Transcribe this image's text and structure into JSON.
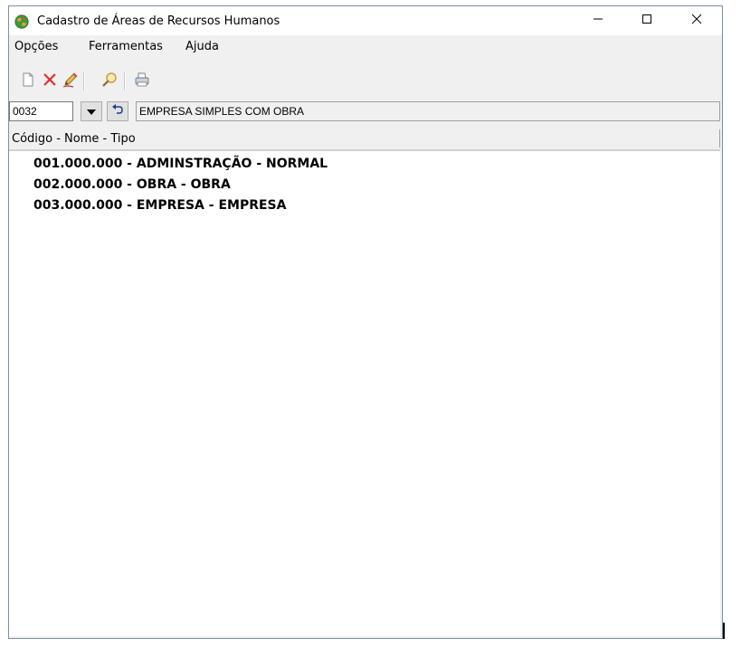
{
  "window": {
    "title": "Cadastro de Áreas de Recursos Humanos",
    "app_icon": "globe-icon",
    "controls": {
      "minimize": "minimize-icon",
      "maximize": "maximize-icon",
      "close": "close-icon"
    }
  },
  "menu": {
    "items": [
      {
        "label": "Opções"
      },
      {
        "label": "Ferramentas"
      },
      {
        "label": "Ajuda"
      }
    ]
  },
  "toolbar": {
    "buttons": [
      {
        "icon": "new-document-icon"
      },
      {
        "icon": "delete-icon"
      },
      {
        "icon": "edit-pencil-icon"
      },
      {
        "icon": "search-icon"
      },
      {
        "icon": "print-icon"
      }
    ]
  },
  "selector": {
    "code_value": "0032",
    "dropdown_icon": "chevron-down-icon",
    "undo_icon": "undo-icon",
    "description": "EMPRESA SIMPLES COM OBRA"
  },
  "list": {
    "header": "Código - Nome - Tipo",
    "rows": [
      {
        "text": "001.000.000 - ADMINSTRAÇÃO - NORMAL"
      },
      {
        "text": "002.000.000 - OBRA - OBRA"
      },
      {
        "text": "003.000.000 - EMPRESA - EMPRESA"
      }
    ]
  },
  "colors": {
    "window_background": "#f0f0f0",
    "list_background": "#ffffff",
    "delete_icon": "#e0302a"
  }
}
